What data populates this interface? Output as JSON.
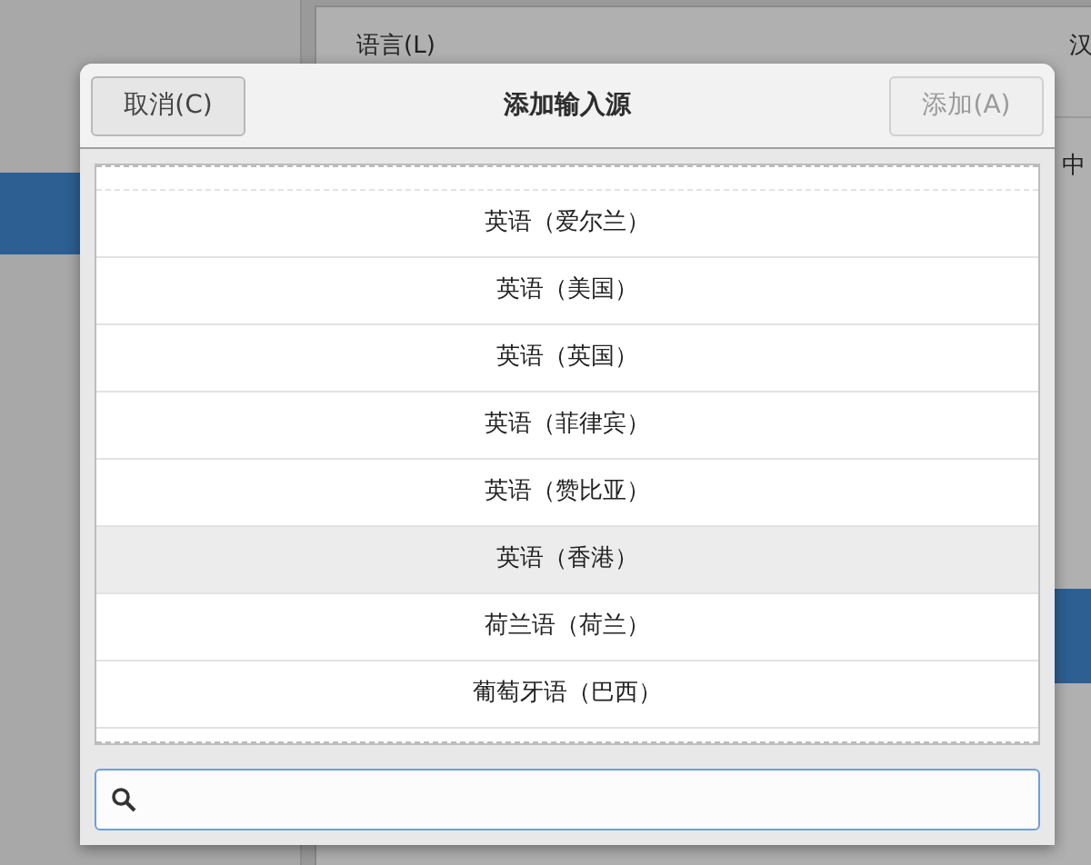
{
  "background": {
    "language_label": "语言(L)",
    "language_value": "汉",
    "format_value": "中"
  },
  "dialog": {
    "title": "添加输入源",
    "cancel_button": "取消(C)",
    "add_button": {
      "label": "添加(A)",
      "disabled": true
    },
    "items": [
      {
        "label": "英语（爱尔兰）",
        "selected": false
      },
      {
        "label": "英语（美国）",
        "selected": false
      },
      {
        "label": "英语（英国）",
        "selected": false
      },
      {
        "label": "英语（菲律宾）",
        "selected": false
      },
      {
        "label": "英语（赞比亚）",
        "selected": false
      },
      {
        "label": "英语（香港）",
        "selected": true
      },
      {
        "label": "荷兰语（荷兰）",
        "selected": false
      },
      {
        "label": "葡萄牙语（巴西）",
        "selected": false
      }
    ]
  }
}
